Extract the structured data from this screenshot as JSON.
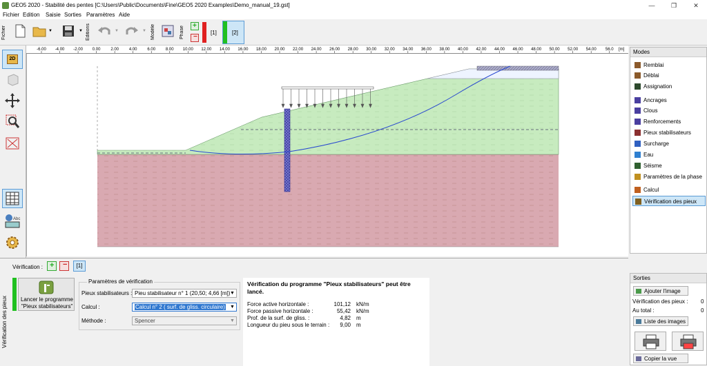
{
  "window": {
    "title": "GEO5 2020 - Stabilité des pentes [C:\\Users\\Public\\Documents\\Fine\\GEO5 2020 Examples\\Demo_manual_19.gst]",
    "minimize": "—",
    "maximize": "❐",
    "close": "✕"
  },
  "menu": [
    "Fichier",
    "Edition",
    "Saisie",
    "Sorties",
    "Paramètres",
    "Aide"
  ],
  "toolbar": {
    "fichier_label": "Fichier",
    "editions_label": "Editions",
    "modele_label": "Modèle",
    "phase_label": "Phase",
    "phase1": "[1]",
    "phase2": "[2]"
  },
  "ruler": {
    "ticks": [
      "-6.00",
      "-4.00",
      "-2.00",
      "0.00",
      "2.00",
      "4.00",
      "6.00",
      "8.00",
      "10.00",
      "12.00",
      "14.00",
      "16.00",
      "18.00",
      "20.00",
      "22.00",
      "24.00",
      "26.00",
      "28.00",
      "30.00",
      "32.00",
      "34.00",
      "36.00",
      "38.00",
      "40.00",
      "42.00",
      "44.00",
      "46.00",
      "48.00",
      "50.00",
      "52.00",
      "54.00",
      "56.0"
    ],
    "unit": "[m]"
  },
  "left_tools": {
    "view2d": "2D"
  },
  "modes": {
    "title": "Modes",
    "items": [
      {
        "label": "Remblai",
        "color": "#8b5a2b"
      },
      {
        "label": "Déblai",
        "color": "#8b5a2b"
      },
      {
        "label": "Assignation",
        "color": "#2e4a2e"
      },
      {
        "label": "Ancrages",
        "color": "#4a3fa0"
      },
      {
        "label": "Clous",
        "color": "#4a3fa0"
      },
      {
        "label": "Renforcements",
        "color": "#4a3fa0"
      },
      {
        "label": "Pieux stabilisateurs",
        "color": "#8b3030"
      },
      {
        "label": "Surcharge",
        "color": "#3060c0"
      },
      {
        "label": "Eau",
        "color": "#3080d0"
      },
      {
        "label": "Séisme",
        "color": "#306030"
      },
      {
        "label": "Paramètres de la phase",
        "color": "#c09020"
      },
      {
        "label": "Calcul",
        "color": "#c06020"
      },
      {
        "label": "Vérification des pieux",
        "color": "#806020"
      }
    ]
  },
  "sorties": {
    "title": "Sorties",
    "add_image": "Ajouter l'image",
    "verif_label": "Vérification des pieux :",
    "verif_count": "0",
    "total_label": "Au total :",
    "total_count": "0",
    "list_images": "Liste des images",
    "copy_view": "Copier la vue"
  },
  "bottom": {
    "side_label": "Vérification des pieux",
    "verif_label": "Vérification :",
    "verif_tab": "[1]",
    "launch_line1": "Lancer le programme",
    "launch_line2": "\"Pieux stabilisateurs\"",
    "params_title": "Paramètres de vérification",
    "pieux_label": "Pieux stabilisateurs :",
    "pieux_value": "Pieu stabilisateur n° 1 (20,50; 4,66 [m])",
    "calcul_label": "Calcul :",
    "calcul_value": "Calcul n° 2 ( surf. de gliss. circulaire)",
    "methode_label": "Méthode :",
    "methode_value": "Spencer"
  },
  "results": {
    "heading": "Vérification du programme \"Pieux stabilisateurs\" peut être lancé.",
    "rows": [
      {
        "label": "Force active horizontale :",
        "value": "101,12",
        "unit": "kN/m"
      },
      {
        "label": "Force passive horizontale :",
        "value": "55,42",
        "unit": "kN/m"
      },
      {
        "label": "Prof. de la surf. de gliss. :",
        "value": "4,82",
        "unit": "m"
      },
      {
        "label": "Longueur du pieu sous le terrain :",
        "value": "9,00",
        "unit": "m"
      }
    ]
  },
  "colors": {
    "soil_green": "#c8ecc0",
    "soil_red": "#d8a8b0",
    "pile": "#6060c0",
    "slip": "#3050d0",
    "selection": "#cde6f7"
  }
}
